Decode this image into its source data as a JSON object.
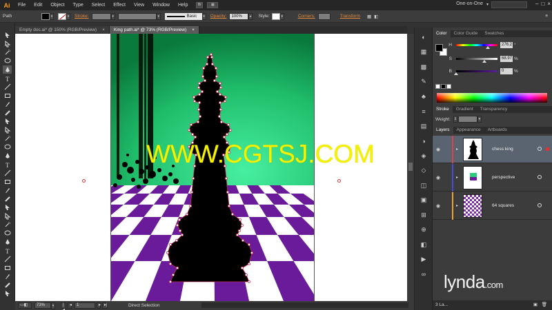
{
  "app": {
    "logo": "Ai",
    "workspace": "One-on-One"
  },
  "menu": [
    "File",
    "Edit",
    "Object",
    "Type",
    "Select",
    "Effect",
    "View",
    "Window",
    "Help"
  ],
  "menu_buttons": [
    "Br"
  ],
  "window_controls": [
    "–",
    "□",
    "×"
  ],
  "control_bar": {
    "selection_type": "Path",
    "stroke_label": "Stroke:",
    "stroke_style": "Basic",
    "opacity_label": "Opacity:",
    "opacity_value": "100%",
    "style_label": "Style:",
    "corners_label": "Corners:",
    "transform_label": "Transform"
  },
  "doc_tabs": [
    {
      "label": "Empty doc.ai* @ 150% (RGB/Preview)",
      "close": "×",
      "active": false
    },
    {
      "label": "King path.ai* @ 73% (RGB/Preview)",
      "close": "×",
      "active": true
    }
  ],
  "watermark": "WWW.CGTSJ.COM",
  "status_bar": {
    "zoom": "73%",
    "artboard": "1",
    "tool_label": "Direct Selection"
  },
  "color_panel": {
    "tabs": [
      "Color",
      "Color Guide",
      "Swatches"
    ],
    "sliders": [
      {
        "label": "H",
        "value": "276.2",
        "unit": "°",
        "position": 0.77
      },
      {
        "label": "S",
        "value": "68.97",
        "unit": "%",
        "position": 0.69
      },
      {
        "label": "B",
        "value": "0",
        "unit": "%",
        "position": 0.0
      }
    ]
  },
  "stroke_panel": {
    "tabs": [
      "Stroke",
      "Gradient",
      "Transparency"
    ],
    "weight_label": "Weight:"
  },
  "layers_panel": {
    "tabs": [
      "Layers",
      "Appearance",
      "Artboards"
    ],
    "layers": [
      {
        "name": "chess king",
        "color": "#e0424b",
        "selected": true
      },
      {
        "name": "perspective",
        "color": "#4b4bd8",
        "selected": false
      },
      {
        "name": "64 squares",
        "color": "#f2a32b",
        "selected": false
      }
    ],
    "footer": "3 La..."
  },
  "brand": {
    "name": "lynda",
    "suffix": ".com"
  },
  "colors": {
    "accent": "#f79a1d",
    "purple": "#6a1b9a",
    "green": "#22d47b",
    "watermark": "#f5f200"
  }
}
